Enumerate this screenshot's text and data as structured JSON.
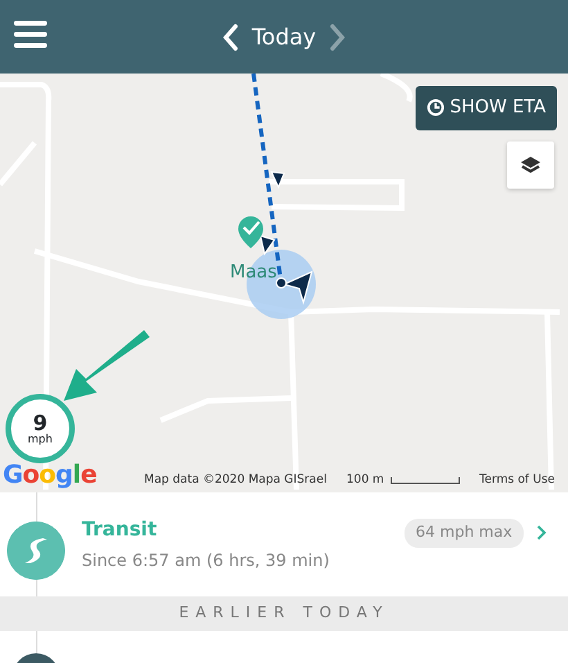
{
  "header": {
    "title": "Today",
    "prev_disabled": false,
    "next_disabled": true
  },
  "map": {
    "eta_button": "SHOW ETA",
    "place_label": "Maas",
    "speed": {
      "value": "9",
      "unit": "mph"
    },
    "logo": "Google",
    "attribution": "Map data ©2020 Mapa GISrael",
    "scale": "100 m",
    "terms": "Terms of Use"
  },
  "activities": [
    {
      "title": "Transit",
      "subtitle": "Since 6:57 am (6 hrs, 39 min)",
      "badge": "64 mph max"
    }
  ],
  "section_header": "EARLIER TODAY"
}
